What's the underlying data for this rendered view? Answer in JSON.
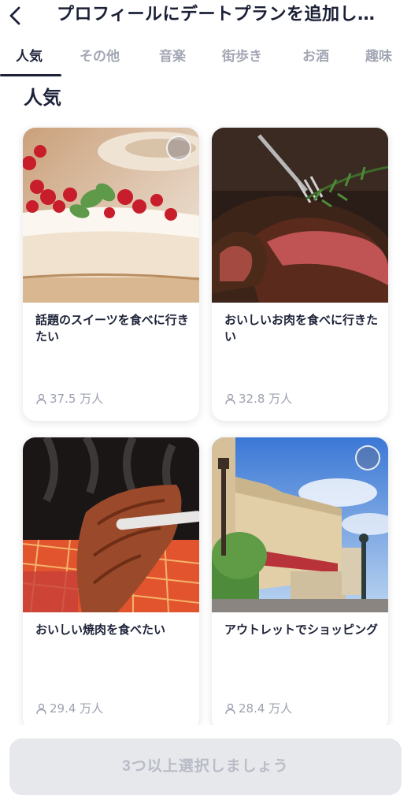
{
  "header": {
    "title": "プロフィールにデートプランを追加し…"
  },
  "tabs": [
    {
      "label": "人気",
      "active": true
    },
    {
      "label": "その他",
      "active": false
    },
    {
      "label": "音楽",
      "active": false
    },
    {
      "label": "街歩き",
      "active": false
    },
    {
      "label": "お酒",
      "active": false
    },
    {
      "label": "趣味",
      "active": false
    }
  ],
  "section": {
    "title": "人気"
  },
  "cards": [
    {
      "title": "話題のスイーツを食べに行きたい",
      "count": "37.5 万人",
      "image_icon": "cake-photo",
      "selected": false
    },
    {
      "title": "おいしいお肉を食べに行きたい",
      "count": "32.8 万人",
      "image_icon": "steak-photo",
      "selected": false
    },
    {
      "title": "おいしい焼肉を食べたい",
      "count": "29.4 万人",
      "image_icon": "yakiniku-photo",
      "selected": false
    },
    {
      "title": "アウトレットでショッピング",
      "count": "28.4 万人",
      "image_icon": "outlet-photo",
      "selected": false
    }
  ],
  "footer": {
    "cta_label": "3つ以上選択しましょう"
  },
  "colors": {
    "text_primary": "#1d2238",
    "text_muted": "#a3a7b4",
    "button_disabled_bg": "#e6e8ec",
    "button_disabled_text": "#b9bcc6"
  }
}
